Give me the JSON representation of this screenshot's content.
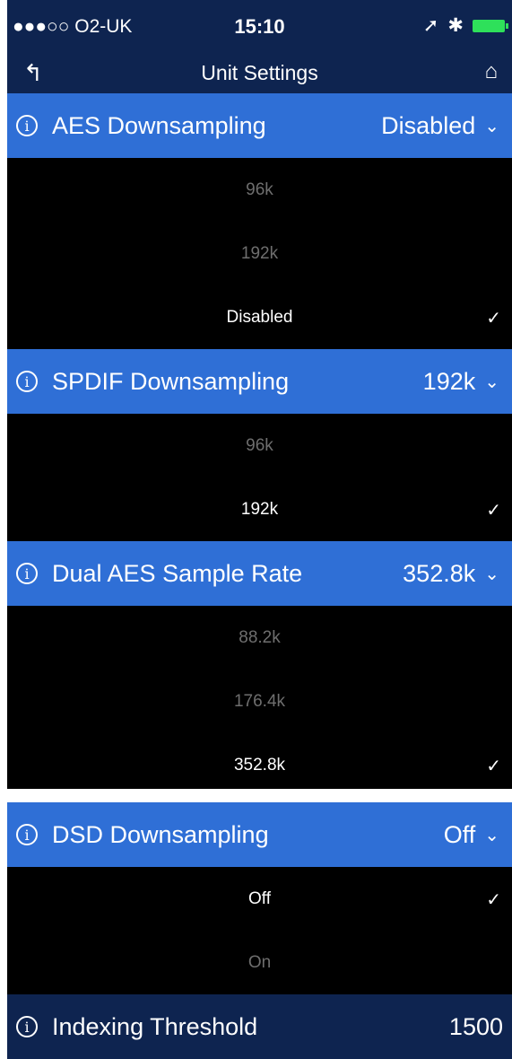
{
  "status": {
    "carrier": "●●●○○ O2-UK",
    "time": "15:10",
    "wifi": "wifi-icon",
    "location": "location-arrow-icon",
    "bluetooth": "bluetooth-icon"
  },
  "nav": {
    "title": "Unit Settings",
    "back_icon": "back-arrow-icon",
    "home_icon": "home-icon"
  },
  "sections": [
    {
      "label": "AES Downsampling",
      "value": "Disabled",
      "options": [
        {
          "label": "96k",
          "selected": false
        },
        {
          "label": "192k",
          "selected": false
        },
        {
          "label": "Disabled",
          "selected": true
        }
      ]
    },
    {
      "label": "SPDIF Downsampling",
      "value": "192k",
      "options": [
        {
          "label": "96k",
          "selected": false
        },
        {
          "label": "192k",
          "selected": true
        }
      ]
    },
    {
      "label": "Dual AES Sample Rate",
      "value": "352.8k",
      "options": [
        {
          "label": "88.2k",
          "selected": false
        },
        {
          "label": "176.4k",
          "selected": false
        },
        {
          "label": "352.8k",
          "selected": true
        }
      ]
    },
    {
      "label": "DSD Downsampling",
      "value": "Off",
      "options": [
        {
          "label": "Off",
          "selected": true
        },
        {
          "label": "On",
          "selected": false
        }
      ]
    }
  ],
  "indexing": {
    "label": "Indexing Threshold",
    "value": "1500"
  },
  "glyphs": {
    "info": "i",
    "chevron": "⌄",
    "check": "✓",
    "back": "↰",
    "home": "⌂",
    "wifi": "≋",
    "location": "➚",
    "bluetooth": "✱"
  },
  "colors": {
    "header_blue": "#2f6fd6",
    "nav_navy": "#0e2450",
    "background": "#000000",
    "dim_text": "#6e6e6e"
  }
}
